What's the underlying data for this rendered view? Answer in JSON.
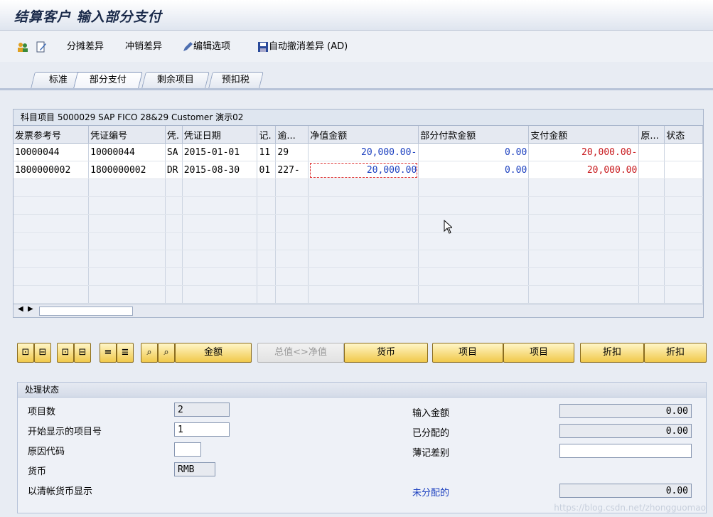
{
  "title": "结算客户 输入部分支付",
  "toolbar": {
    "split_diff": "分摊差异",
    "writeoff_diff": "冲销差异",
    "edit_options": "编辑选项",
    "auto_writeoff": "自动撤消差异 (AD)"
  },
  "tabs": [
    {
      "label": "标准"
    },
    {
      "label": "部分支付"
    },
    {
      "label": "剩余项目"
    },
    {
      "label": "预扣税"
    }
  ],
  "grid": {
    "account_header": "科目项目 5000029 SAP FICO 28&29 Customer 演示02",
    "columns": [
      "发票参考号",
      "凭证编号",
      "凭.",
      "凭证日期",
      "记.",
      "逾...",
      "净值金额",
      "部分付款金额",
      "支付金额",
      "原...",
      "状态"
    ],
    "rows": [
      {
        "invoice_ref": "10000044",
        "doc_no": "10000044",
        "doc_type": "SA",
        "doc_date": "2015-01-01",
        "posting_key": "11",
        "overdue": "29",
        "net_amount": "20,000.00-",
        "partial_amount": "0.00",
        "payment_amount": "20,000.00-"
      },
      {
        "invoice_ref": "1800000002",
        "doc_no": "1800000002",
        "doc_type": "DR",
        "doc_date": "2015-08-30",
        "posting_key": "01",
        "overdue": "227-",
        "net_amount": "20,000.00",
        "partial_amount": "0.00",
        "payment_amount": "20,000.00"
      }
    ]
  },
  "buttons": {
    "amount": "金额",
    "gross_net": "总值<>净值",
    "currency": "货币",
    "item1": "项目",
    "item2": "项目",
    "discount1": "折扣",
    "discount2": "折扣"
  },
  "status": {
    "header": "处理状态",
    "item_count_label": "项目数",
    "item_count": "2",
    "first_item_label": "开始显示的项目号",
    "first_item": "1",
    "reason_code_label": "原因代码",
    "reason_code": "",
    "currency_label": "货币",
    "currency": "RMB",
    "clearing_currency_label": "以清帐货币显示",
    "entered_amount_label": "输入金额",
    "entered_amount": "0.00",
    "assigned_label": "已分配的",
    "assigned": "0.00",
    "posting_diff_label": "薄记差别",
    "posting_diff": "",
    "unassigned_label": "未分配的",
    "unassigned": "0.00"
  },
  "colors": {
    "accent_blue": "#1b3fbf",
    "payment_red": "#c8191d"
  },
  "watermark": "https://blog.csdn.net/zhongguomao"
}
